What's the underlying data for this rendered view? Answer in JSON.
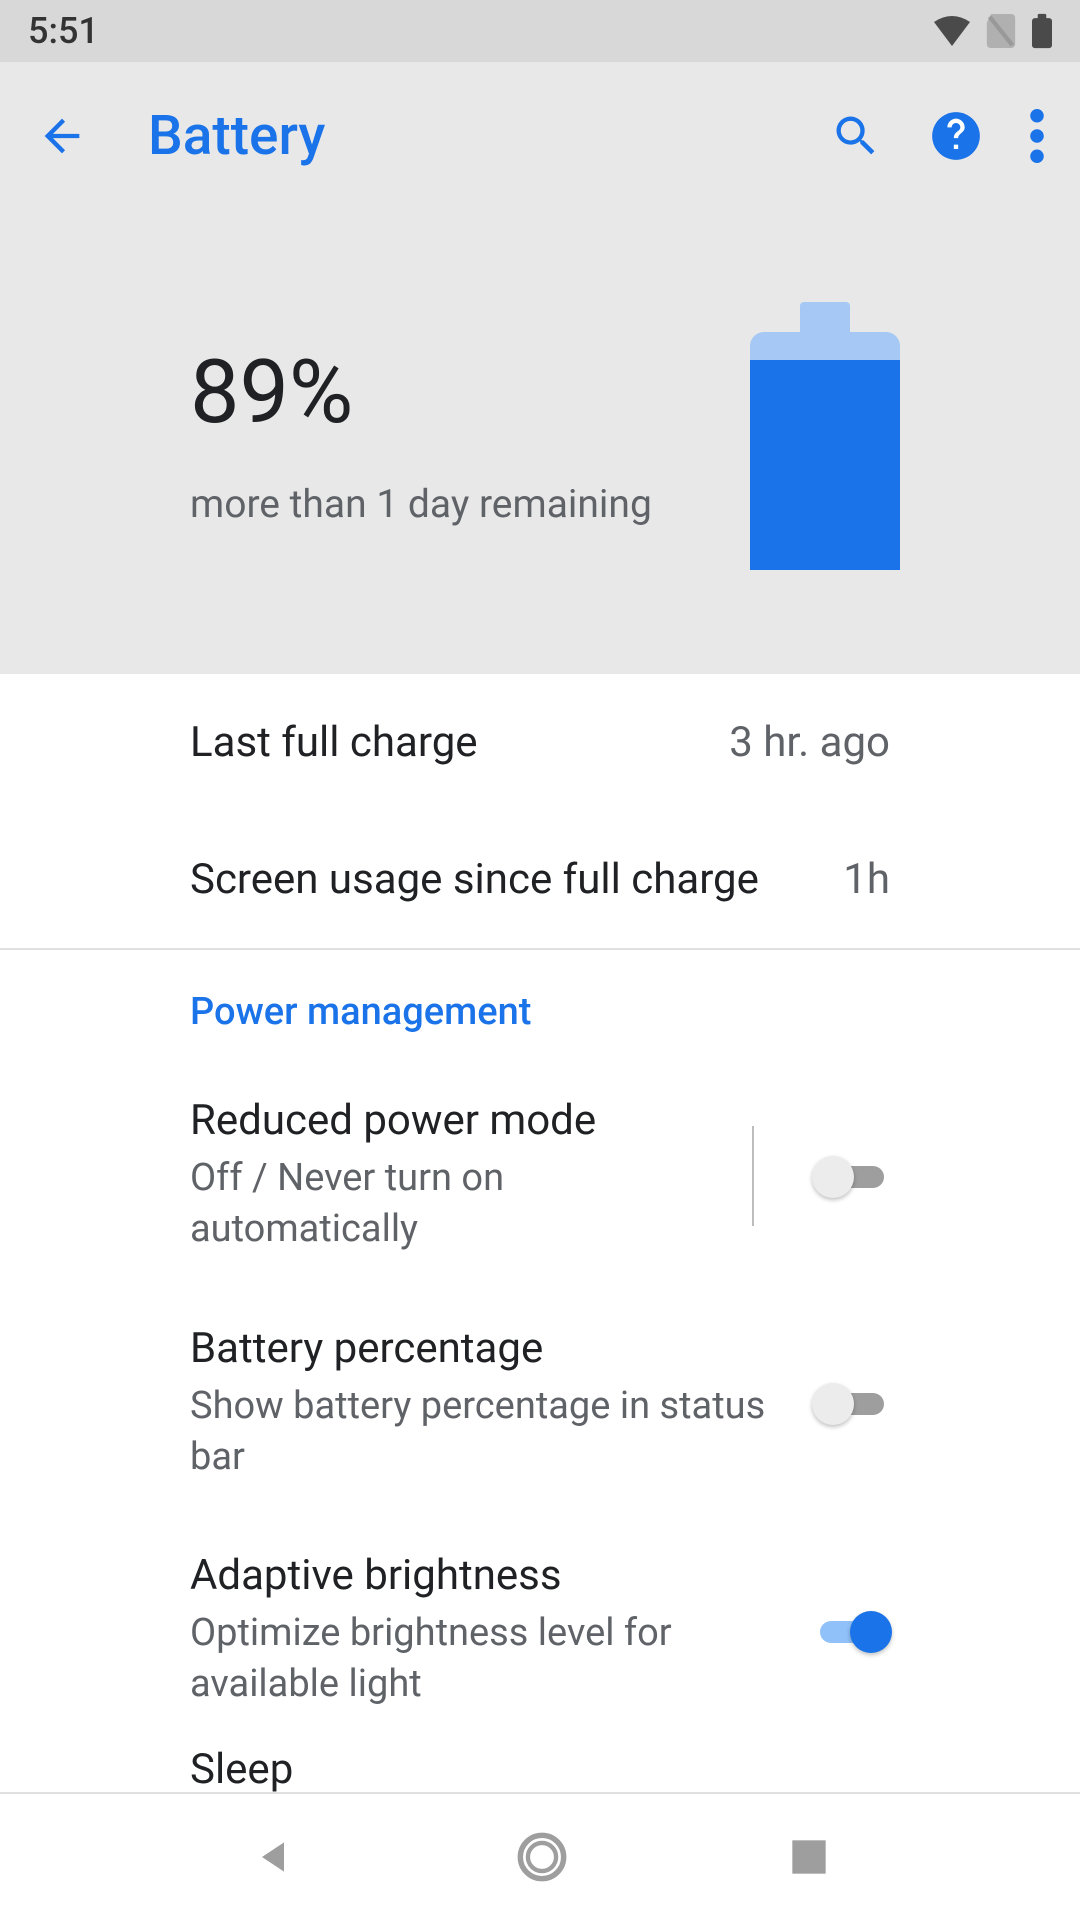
{
  "status_bar": {
    "time": "5:51"
  },
  "header": {
    "title": "Battery",
    "percent": "89%",
    "remaining": "more than 1 day remaining",
    "fill_percent": 89
  },
  "info": {
    "last_full_charge_label": "Last full charge",
    "last_full_charge_value": "3 hr. ago",
    "screen_usage_label": "Screen usage since full charge",
    "screen_usage_value": "1h"
  },
  "section": {
    "title": "Power management"
  },
  "settings": {
    "reduced_power": {
      "title": "Reduced power mode",
      "subtitle": "Off / Never turn on automatically",
      "enabled": false
    },
    "battery_percentage": {
      "title": "Battery percentage",
      "subtitle": "Show battery percentage in status bar",
      "enabled": false
    },
    "adaptive_brightness": {
      "title": "Adaptive brightness",
      "subtitle": "Optimize brightness level for available light",
      "enabled": true
    },
    "sleep": {
      "title": "Sleep"
    }
  },
  "colors": {
    "accent": "#1a73e8",
    "text_primary": "#202124",
    "text_secondary": "#5f6368",
    "header_bg": "#e8e8e8",
    "status_bg": "#d8d8d8"
  }
}
